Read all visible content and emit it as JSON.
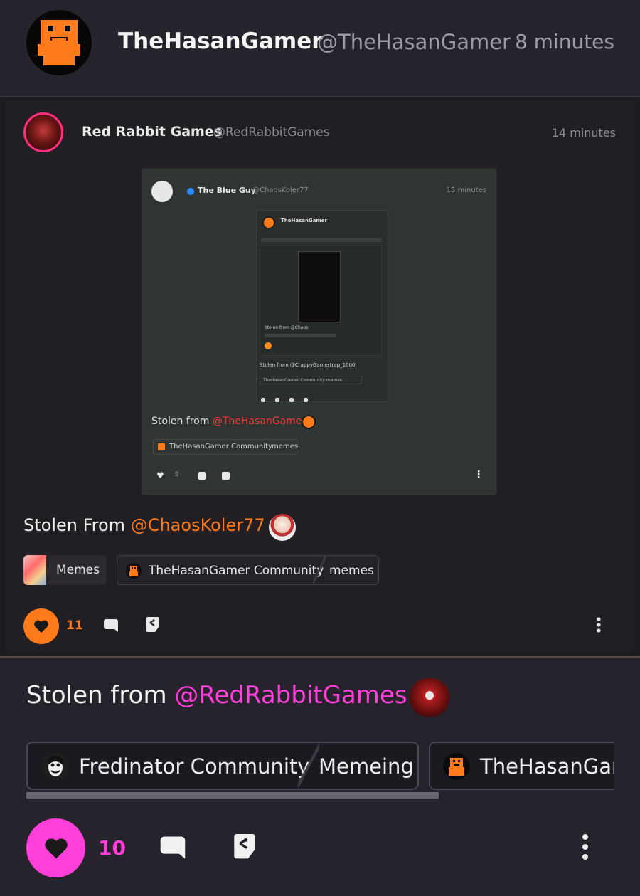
{
  "post": {
    "author_name": "TheHasanGamer",
    "author_handle": "@TheHasanGamer",
    "time": "8 minutes",
    "text_prefix": "Stolen from ",
    "mention": "@RedRabbitGames",
    "tags": [
      {
        "community": "Fredinator Community",
        "topic": "Memeing"
      },
      {
        "community": "TheHasanGam"
      }
    ],
    "like_count": "10",
    "accent_color": "#ff3fd9"
  },
  "embedded": {
    "author_name": "Red Rabbit Games",
    "author_handle": "@RedRabbitGames",
    "time": "14 minutes",
    "text_prefix": "Stolen From ",
    "mention": "@ChaosKoler77",
    "tag_simple": "Memes",
    "tag_community": "TheHasanGamer Community",
    "tag_topic": "memes",
    "like_count": "11",
    "accent_color": "#ff7a1a",
    "screenshot": {
      "author_name": "The Blue Guy",
      "author_handle": "@ChaosKoler77",
      "time": "15 minutes",
      "inner_author": "TheHasanGamer",
      "inner_stolen_small": "Stolen from @Chaos",
      "inner_stolen": "Stolen from @CrappyGamertrap_1000",
      "inner_tag": "TheHasanGamer Community   memes",
      "text_prefix": "Stolen from ",
      "mention": "@TheHasanGamer",
      "tag_community": "TheHasanGamer Community",
      "tag_topic": "memes",
      "like_count": "9"
    }
  },
  "icons": {
    "like": "heart-icon",
    "comment": "comment-icon",
    "share": "share-icon",
    "more": "more-vertical-icon"
  }
}
